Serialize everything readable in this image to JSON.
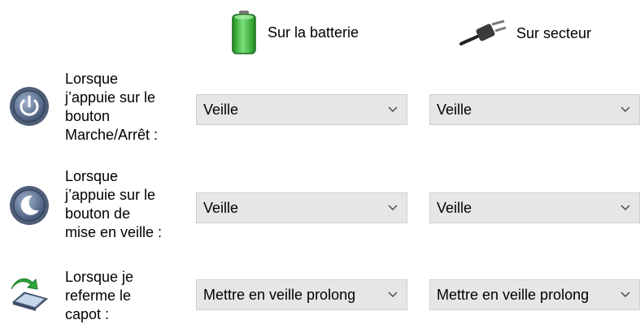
{
  "columns": {
    "battery_label": "Sur la batterie",
    "ac_label": "Sur secteur",
    "battery_icon": "battery-icon",
    "ac_icon": "power-plug-icon"
  },
  "rows": [
    {
      "icon": "power-button-icon",
      "label": "Lorsque\nj’appuie sur le\nbouton\nMarche/Arrêt :",
      "battery_value": "Veille",
      "ac_value": "Veille"
    },
    {
      "icon": "sleep-button-icon",
      "label": "Lorsque\nj’appuie sur le\nbouton de\nmise en veille :",
      "battery_value": "Veille",
      "ac_value": "Veille"
    },
    {
      "icon": "laptop-lid-icon",
      "label": "Lorsque je\nreferme le\ncapot :",
      "battery_value": "Mettre en veille prolong",
      "ac_value": "Mettre en veille prolong"
    }
  ],
  "colors": {
    "dropdown_bg": "#e6e6e6",
    "battery_green": "#3fb13f"
  }
}
